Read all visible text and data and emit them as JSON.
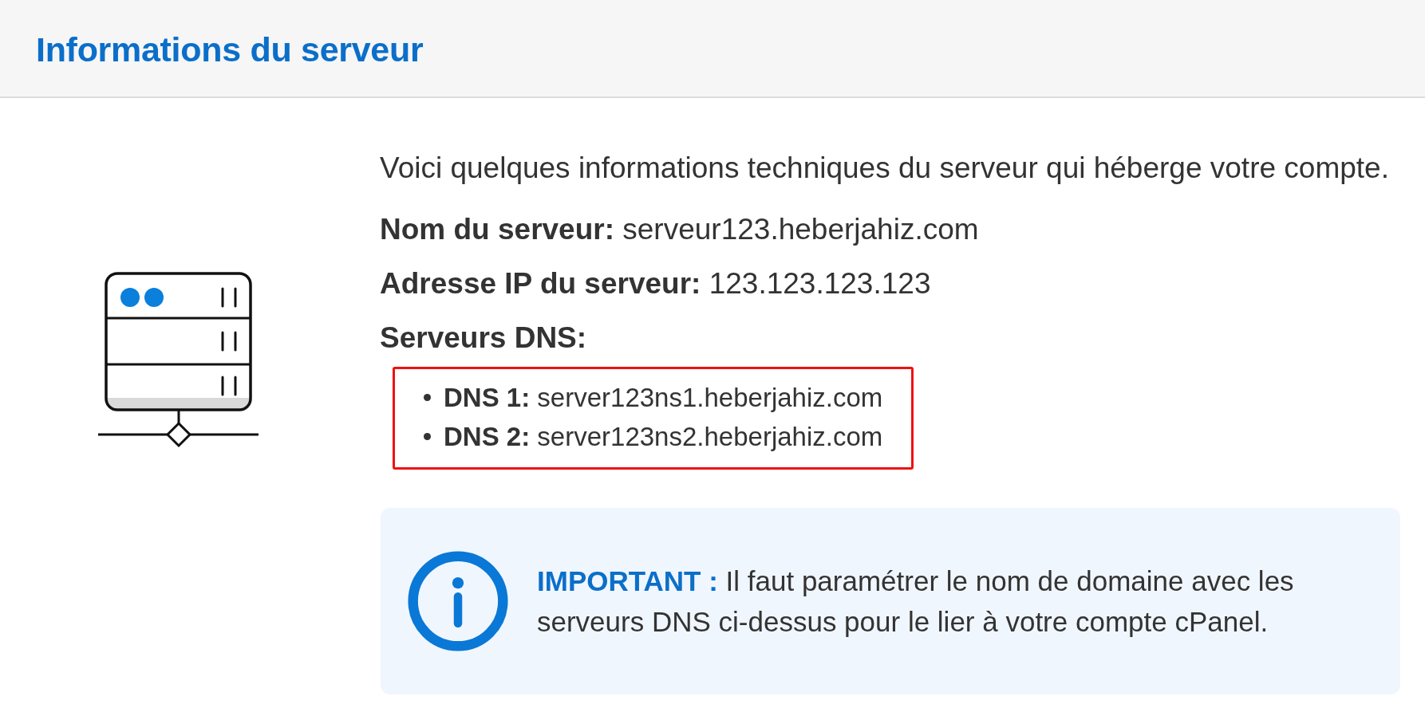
{
  "header": {
    "title": "Informations du serveur"
  },
  "intro": "Voici quelques informations techniques du serveur qui héberge votre compte.",
  "fields": [
    {
      "label": "Nom du serveur:",
      "value": "serveur123.heberjahiz.com"
    },
    {
      "label": "Adresse IP du serveur:",
      "value": "123.123.123.123"
    }
  ],
  "dns_heading": "Serveurs DNS:",
  "dns_list": {
    "highlighted": true,
    "items": [
      {
        "label": "DNS 1:",
        "value": "server123ns1.heberjahiz.com"
      },
      {
        "label": "DNS 2:",
        "value": "server123ns2.heberjahiz.com"
      }
    ]
  },
  "notice": {
    "label": "IMPORTANT :",
    "text": "Il faut paramétrer le nom de domaine avec les serveurs DNS ci-dessus pour le lier à votre compte cPanel."
  }
}
